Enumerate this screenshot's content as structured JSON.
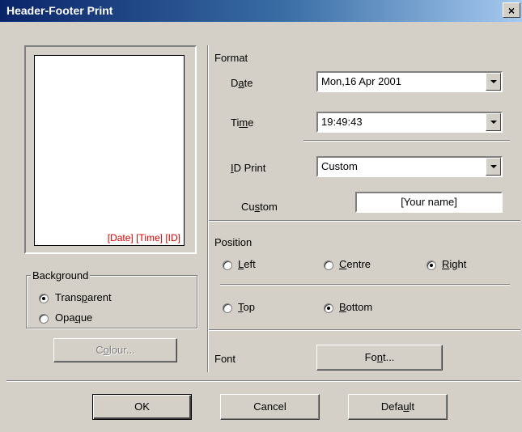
{
  "window": {
    "title": "Header-Footer Print",
    "close_symbol": "×"
  },
  "preview": {
    "text": "[Date] [Time] [ID]",
    "text_color": "#e00000"
  },
  "background": {
    "label": "Background",
    "transparent": {
      "label": "Transparent",
      "checked": true
    },
    "opaque": {
      "label": "Opaque",
      "checked": false
    },
    "colour_button": "Colour..."
  },
  "format": {
    "label": "Format",
    "date": {
      "label": "Date",
      "value": "Mon,16 Apr 2001"
    },
    "time": {
      "label": "Time",
      "value": "19:49:43"
    },
    "id_print": {
      "label": "ID Print",
      "value": "Custom"
    },
    "custom": {
      "label": "Custom",
      "value": "[Your name]"
    }
  },
  "position": {
    "label": "Position",
    "left": {
      "label": "Left",
      "checked": false
    },
    "centre": {
      "label": "Centre",
      "checked": false
    },
    "right": {
      "label": "Right",
      "checked": true
    },
    "top": {
      "label": "Top",
      "checked": false
    },
    "bottom": {
      "label": "Bottom",
      "checked": true
    }
  },
  "font": {
    "label": "Font",
    "button": "Font..."
  },
  "footer_buttons": {
    "ok": "OK",
    "cancel": "Cancel",
    "default": "Default"
  },
  "colors": {
    "title_start": "#0a246a",
    "title_end": "#a6caf0",
    "face": "#d4d0c8"
  }
}
